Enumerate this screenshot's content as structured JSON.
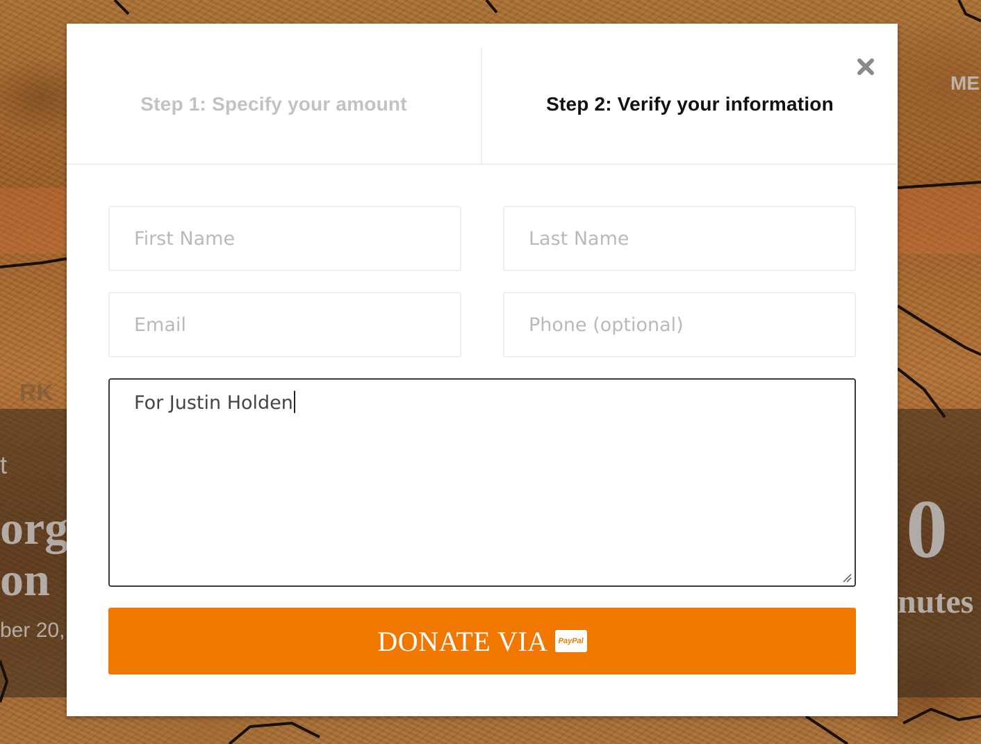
{
  "background": {
    "nav_fragment": "ME",
    "label_left_small": "t",
    "title_fragment_1": "orge",
    "title_fragment_2": "on",
    "date_fragment": "ber 20,",
    "countdown_digit": "0",
    "countdown_unit_fragment": "nutes",
    "map_label_fragment": "RK"
  },
  "modal": {
    "steps": {
      "step1_label": "Step 1: Specify your amount",
      "step2_label": "Step 2: Verify your information"
    },
    "form": {
      "first_name_placeholder": "First Name",
      "last_name_placeholder": "Last Name",
      "email_placeholder": "Email",
      "phone_placeholder": "Phone (optional)",
      "message_value": "For Justin Holden"
    },
    "donate_button": {
      "label": "DONATE VIA",
      "badge": "PayPal"
    }
  },
  "colors": {
    "accent": "#f07800",
    "step_inactive": "#c2c2c2",
    "step_active": "#111111"
  },
  "icons": {
    "close": "close-icon",
    "resize": "resize-handle-icon"
  }
}
